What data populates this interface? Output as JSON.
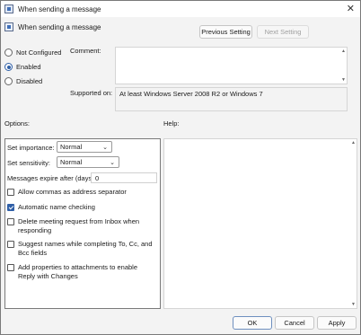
{
  "window": {
    "title": "When sending a message",
    "close_glyph": "✕"
  },
  "header": {
    "policy_name": "When sending a message"
  },
  "nav": {
    "previous_label": "Previous Setting",
    "next_label": "Next Setting"
  },
  "state": {
    "options": [
      {
        "label": "Not Configured",
        "checked": false
      },
      {
        "label": "Enabled",
        "checked": true
      },
      {
        "label": "Disabled",
        "checked": false
      }
    ]
  },
  "comment": {
    "label": "Comment:",
    "value": ""
  },
  "supported": {
    "label": "Supported on:",
    "value": "At least Windows Server 2008 R2 or Windows 7"
  },
  "sections": {
    "options_label": "Options:",
    "help_label": "Help:"
  },
  "options": {
    "importance": {
      "label": "Set importance:",
      "value": "Normal"
    },
    "sensitivity": {
      "label": "Set sensitivity:",
      "value": "Normal"
    },
    "expire": {
      "label": "Messages expire after (days):",
      "value": "0"
    },
    "checkboxes": [
      {
        "label": "Allow commas as address separator",
        "checked": false
      },
      {
        "label": "Automatic name checking",
        "checked": true
      },
      {
        "label": "Delete meeting request from Inbox when responding",
        "checked": false
      },
      {
        "label": "Suggest names while completing To, Cc, and Bcc fields",
        "checked": false
      },
      {
        "label": "Add properties to attachments to enable Reply with Changes",
        "checked": false
      }
    ]
  },
  "footer": {
    "ok_label": "OK",
    "cancel_label": "Cancel",
    "apply_label": "Apply"
  },
  "icons": {
    "policy": "policy-settings-icon",
    "dropdown": "chevron-down-icon"
  }
}
